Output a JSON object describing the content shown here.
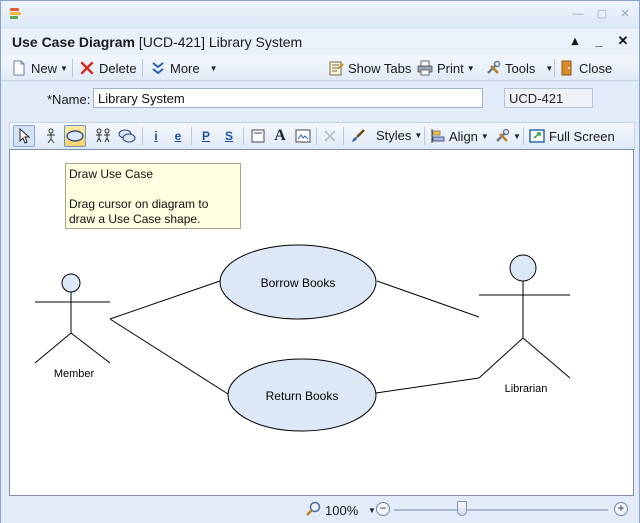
{
  "window": {
    "title_bold": "Use Case Diagram",
    "title_rest": " [UCD-421] Library System",
    "pin": "▴",
    "minimize": "_",
    "close": "✕"
  },
  "toolbar": {
    "new_label": "New",
    "delete_label": "Delete",
    "more_label": "More",
    "show_tabs_label": "Show Tabs",
    "print_label": "Print",
    "tools_label": "Tools",
    "close_label": "Close"
  },
  "form": {
    "name_label": "*Name:",
    "name_value": "Library System",
    "id_value": "UCD-421"
  },
  "diagram_toolbar": {
    "styles_label": "Styles",
    "align_label": "Align",
    "full_screen_label": "Full Screen",
    "btn_i": "i",
    "btn_e": "e",
    "btn_p": "P",
    "btn_s": "S",
    "btn_a": "A"
  },
  "tooltip": {
    "title": "Draw Use Case",
    "body": "Drag cursor on diagram to draw a Use Case shape."
  },
  "diagram": {
    "actors": [
      {
        "name": "Member"
      },
      {
        "name": "Librarian"
      }
    ],
    "use_cases": [
      {
        "name": "Borrow Books"
      },
      {
        "name": "Return Books"
      }
    ]
  },
  "status": {
    "zoom_label": "100%",
    "zoom_level": 1.0
  },
  "colors": {
    "accent": "#3a6fb0",
    "canvas_bg": "#ffffff",
    "ellipse_fill": "#dde8f7",
    "tooltip_bg": "#ffffe1"
  }
}
